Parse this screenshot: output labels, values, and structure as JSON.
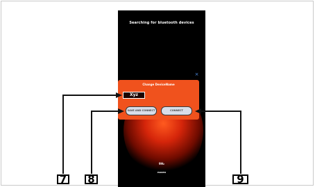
{
  "screen": {
    "title": "Searching for bluetooth devices",
    "close_glyph": "×",
    "bottom_value": "9H₂",
    "bottom_sub": "PAIRED"
  },
  "dialog": {
    "title": "Change DeviceName",
    "name_value": "Xyz",
    "save_connect_label": "SAVE AND CONNECT",
    "connect_label": "CONNECT"
  },
  "callouts": {
    "name_field": "7",
    "save_connect": "8",
    "connect": "9"
  },
  "colors": {
    "dialog_bg": "#f0521d",
    "glow": "#d5250a",
    "close_icon": "#4f8fe6",
    "button_bg": "#d8dee8"
  }
}
